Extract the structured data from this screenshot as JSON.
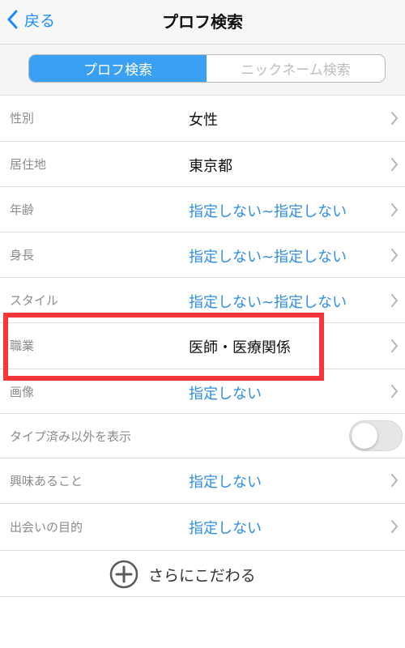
{
  "nav": {
    "back_label": "戻る",
    "title": "プロフ検索"
  },
  "segmented": {
    "active": "プロフ検索",
    "inactive": "ニックネーム検索"
  },
  "rows": {
    "gender": {
      "label": "性別",
      "value": "女性"
    },
    "residence": {
      "label": "居住地",
      "value": "東京都"
    },
    "age": {
      "label": "年齢",
      "value": "指定しない~指定しない"
    },
    "height": {
      "label": "身長",
      "value": "指定しない~指定しない"
    },
    "style": {
      "label": "スタイル",
      "value": "指定しない~指定しない"
    },
    "occupation": {
      "label": "職業",
      "value": "医師・医療関係"
    },
    "image": {
      "label": "画像",
      "value": "指定しない"
    },
    "show_other": {
      "label": "タイプ済み以外を表示",
      "toggle_on": false
    },
    "interests": {
      "label": "興味あること",
      "value": "指定しない"
    },
    "purpose": {
      "label": "出会いの目的",
      "value": "指定しない"
    }
  },
  "more": {
    "label": "さらにこだわる"
  },
  "colors": {
    "accent": "#2f8ee8",
    "segment_active": "#3aa0f4",
    "highlight": "#f5373c"
  },
  "icons": {
    "back": "chevron-left-icon",
    "row": "chevron-right-icon",
    "more": "plus-circle-icon"
  }
}
